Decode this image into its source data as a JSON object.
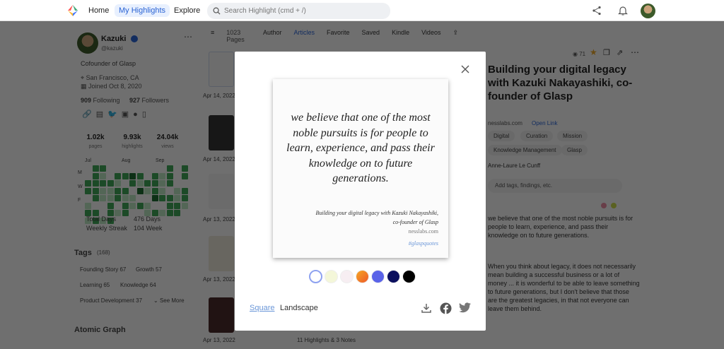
{
  "nav": {
    "home": "Home",
    "my_highlights": "My Highlights",
    "explore": "Explore",
    "search_placeholder": "Search Highlight (cmd + /)"
  },
  "profile": {
    "name": "Kazuki",
    "handle": "@kazuki",
    "bio": "Cofounder of Glasp",
    "location": "San Francisco, CA",
    "joined": "Joined Oct 8, 2020",
    "following_count": "909",
    "following_label": "Following",
    "followers_count": "927",
    "followers_label": "Followers",
    "stats": [
      {
        "value": "1.02k",
        "label": "pages"
      },
      {
        "value": "9.93k",
        "label": "highlights"
      },
      {
        "value": "24.04k",
        "label": "views"
      }
    ],
    "months": [
      "Jul",
      "Aug",
      "Sep"
    ],
    "days": [
      "M",
      "W",
      "F"
    ],
    "total_days_label": "Total Days",
    "total_days": "476 Days",
    "weekly_streak_label": "Weekly Streak",
    "weekly_streak": "104 Week",
    "heat_levels": [
      0,
      2,
      2,
      0,
      0,
      0,
      0,
      0,
      0,
      0,
      0,
      2,
      0,
      2,
      0,
      2,
      1,
      0,
      2,
      2,
      3,
      2,
      0,
      2,
      1,
      2,
      0,
      2,
      2,
      2,
      2,
      2,
      1,
      0,
      2,
      1,
      2,
      2,
      1,
      2,
      0,
      0,
      2,
      2,
      1,
      1,
      2,
      2,
      0,
      3,
      1,
      2,
      1,
      0,
      1,
      2,
      0,
      2,
      1,
      1,
      2,
      1,
      1,
      0,
      0,
      3,
      2,
      2,
      1,
      2,
      1,
      0,
      0,
      2,
      0,
      2,
      1,
      2,
      1,
      0,
      0,
      2,
      2,
      1,
      2,
      2,
      0,
      2,
      1,
      2,
      0,
      0,
      1,
      2,
      1,
      2,
      2,
      0,
      1,
      2,
      1,
      2
    ]
  },
  "tags": {
    "title": "Tags",
    "count": "(168)",
    "items": [
      "Founding Story 67",
      "Growth 57",
      "Learning 65",
      "Knowledge 64",
      "Product Development 37"
    ],
    "see_more": "See More"
  },
  "atomic_graph": "Atomic Graph",
  "filters": {
    "pages": "1023 Pages",
    "items": [
      "Author",
      "Articles",
      "Favorite",
      "Saved",
      "Kindle",
      "Videos"
    ],
    "active": "Articles"
  },
  "list": {
    "dates": [
      "Apr 14, 2022",
      "Apr 14, 2022",
      "Apr 13, 2022",
      "Apr 13, 2022",
      "Apr 13, 2022"
    ],
    "footer": "11 Highlights & 3 Notes"
  },
  "detail": {
    "views": "71",
    "title": "Building your digital legacy with Kazuki Nakayashiki, co-founder of Glasp",
    "source": "nesslabs.com",
    "open_link": "Open Link",
    "tags": [
      "Digital",
      "Curation",
      "Mission",
      "Knowledge Management",
      "Glasp"
    ],
    "author": "Anne-Laure Le Cunff",
    "note_placeholder": "Add tags, findings, etc.",
    "highlight": "we believe that one of the most noble pursuits is for people to learn, experience, and pass their knowledge on to future generations.",
    "body": "When you think about legacy, it does not necessarily mean building a successful business or a lot of money ... it is wonderful to be able to leave something to future generations, but I don't believe that those are the greatest legacies, in that not everyone can leave them behind."
  },
  "modal": {
    "quote": "we believe that one of the most noble pursuits is for people to learn, experience, and pass their knowledge on to future generations.",
    "source_title": "Building your digital legacy with Kazuki Nakayashiki,",
    "source_title2": "co-founder of Glasp",
    "site": "nesslabs.com",
    "hashtag": "#glaspquotes",
    "swatches": [
      "#ffffff",
      "#f4f7d9",
      "#f7eef2",
      "#f07a2a",
      "#5a63e8",
      "#0b0f5e",
      "#000000"
    ],
    "selected_swatch": 0,
    "format_square": "Square",
    "format_landscape": "Landscape"
  }
}
